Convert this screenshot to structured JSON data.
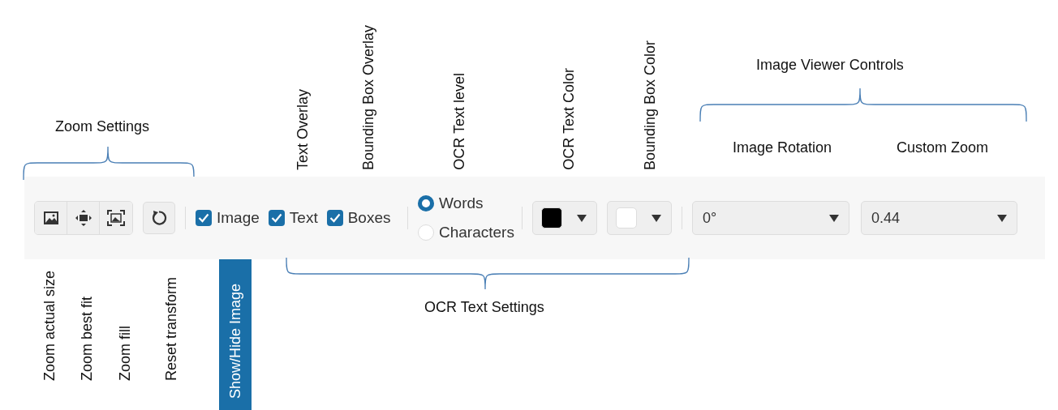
{
  "annotations": {
    "top_labels": [
      "Text Overlay",
      "Bounding Box Overlay",
      "OCR Text level",
      "OCR Text Color",
      "Bounding Box Color"
    ],
    "zoom_settings": "Zoom Settings",
    "image_viewer_controls": "Image Viewer Controls",
    "dropdown_labels": [
      "Image Rotation",
      "Custom Zoom"
    ],
    "bottom_labels": [
      "Zoom actual size",
      "Zoom best fit",
      "Zoom fill",
      "Reset transform"
    ],
    "show_hide": "Show/Hide Image",
    "ocr_text_settings": "OCR Text Settings"
  },
  "toolbar": {
    "buttons": [
      {
        "kind": "actual-size"
      },
      {
        "kind": "best-fit"
      },
      {
        "kind": "fill"
      },
      {
        "kind": "reset"
      }
    ],
    "checkboxes": [
      {
        "label": "Image",
        "checked": true
      },
      {
        "label": "Text",
        "checked": true
      },
      {
        "label": "Boxes",
        "checked": true
      }
    ],
    "ocr_level": [
      {
        "label": "Words",
        "selected": true
      },
      {
        "label": "Characters",
        "selected": false
      }
    ],
    "color_pickers": [
      {
        "color": "#000000"
      },
      {
        "color": "#ffffff"
      }
    ],
    "dropdowns": [
      {
        "value": "0°"
      },
      {
        "value": "0.44"
      }
    ]
  }
}
